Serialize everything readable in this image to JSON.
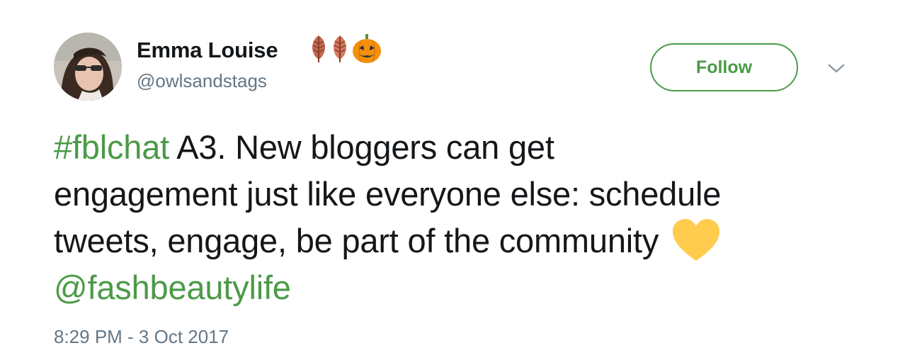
{
  "author": {
    "display_name": "Emma Louise",
    "handle": "@owlsandstags",
    "name_emojis": [
      "leaf-emoji",
      "leaf-emoji",
      "jack-o-lantern-emoji"
    ]
  },
  "actions": {
    "follow_label": "Follow",
    "menu_icon": "chevron-down-icon"
  },
  "tweet": {
    "hashtag": "#fblchat",
    "line1_rest": " A3. New bloggers can get",
    "line2": "engagement just like everyone else: schedule",
    "line3": "tweets, engage, be part of the community",
    "heart_icon": "yellow-heart-emoji",
    "mention": "@fashbeautylife"
  },
  "meta": {
    "timestamp": "8:29 PM - 3 Oct 2017"
  },
  "colors": {
    "accent": "#4b9a47",
    "text": "#14171a",
    "secondary": "#657786",
    "heart": "#ffcc4d",
    "pumpkin": "#f4900c",
    "leaf": "#c1694f"
  }
}
